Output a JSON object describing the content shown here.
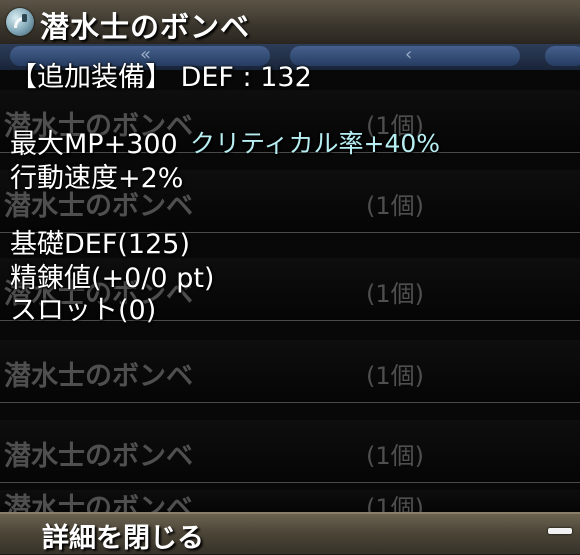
{
  "item": {
    "name": "潜水士のボンベ",
    "icon": "diving-tank-icon"
  },
  "nav": {
    "prev_glyph": "«",
    "left_glyph": "‹"
  },
  "list": {
    "rows": [
      {
        "name": "潜水士のボンベ",
        "qty": "(1個)"
      },
      {
        "name": "潜水士のボンベ",
        "qty": "(1個)"
      },
      {
        "name": "潜水士のボンベ",
        "qty": "(1個)"
      },
      {
        "name": "潜水士のボンベ",
        "qty": "(1個)"
      },
      {
        "name": "潜水士のボンベ",
        "qty": "(1個)"
      },
      {
        "name": "潜水士のボンベ",
        "qty": "(1個)"
      }
    ]
  },
  "details": {
    "added_equipment": "【追加装備】 DEF : 132",
    "max_mp": "最大MP+300",
    "crit_rate": "クリティカル率+40%",
    "action_speed": "行動速度+2%",
    "base_def": "基礎DEF(125)",
    "refine": "精錬値(+0/0 pt)",
    "slot": "スロット(0)"
  },
  "footer": {
    "close_label": "詳細を閉じる",
    "collapse_icon": "minus-icon"
  },
  "colors": {
    "stat_text": "#ffffff",
    "highlight_text": "#b6eef2",
    "dim_row_text": "#4f4f4f"
  }
}
